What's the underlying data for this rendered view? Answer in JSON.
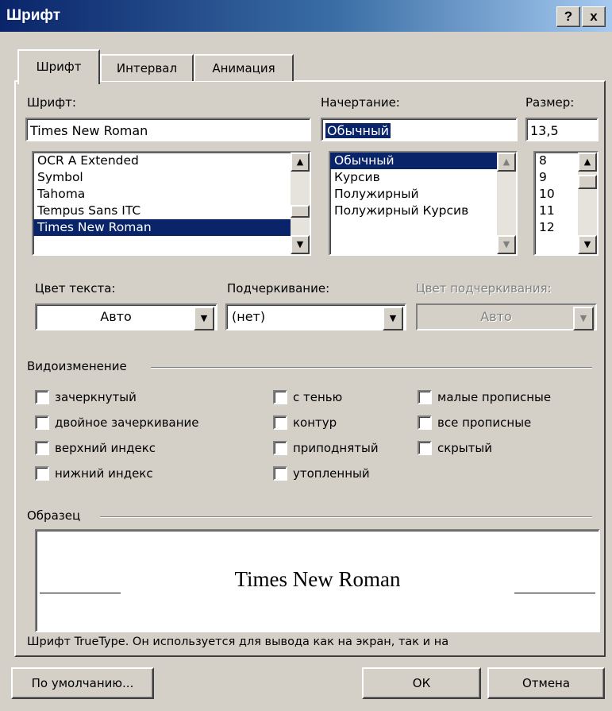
{
  "window": {
    "title": "Шрифт",
    "help_glyph": "?",
    "close_glyph": "x"
  },
  "tabs": [
    {
      "label": "Шрифт",
      "active": true
    },
    {
      "label": "Интервал",
      "active": false
    },
    {
      "label": "Анимация",
      "active": false
    }
  ],
  "font": {
    "label": "Шрифт:",
    "value": "Times New Roman",
    "list": [
      "OCR A Extended",
      "Symbol",
      "Tahoma",
      "Tempus Sans ITC",
      "Times New Roman"
    ],
    "selected": "Times New Roman"
  },
  "style": {
    "label": "Начертание:",
    "value": "Обычный",
    "list": [
      "Обычный",
      "Курсив",
      "Полужирный",
      "Полужирный Курсив"
    ],
    "selected": "Обычный"
  },
  "size": {
    "label": "Размер:",
    "value": "13,5",
    "list": [
      "8",
      "9",
      "10",
      "11",
      "12"
    ]
  },
  "text_color": {
    "label": "Цвет текста:",
    "value": "Авто"
  },
  "underline": {
    "label": "Подчеркивание:",
    "value": "(нет)"
  },
  "underline_color": {
    "label": "Цвет подчеркивания:",
    "value": "Авто",
    "disabled": true
  },
  "effects": {
    "label": "Видоизменение",
    "col1": [
      "зачеркнутый",
      "двойное зачеркивание",
      "верхний индекс",
      "нижний индекс"
    ],
    "col2": [
      "с тенью",
      "контур",
      "приподнятый",
      "утопленный"
    ],
    "col3": [
      "малые прописные",
      "все прописные",
      "скрытый"
    ]
  },
  "preview": {
    "label": "Образец",
    "sample_text": "Times New Roman",
    "note": "Шрифт TrueType. Он используется для вывода как на экран, так и на"
  },
  "buttons": {
    "default": "По умолчанию...",
    "ok": "ОК",
    "cancel": "Отмена"
  }
}
